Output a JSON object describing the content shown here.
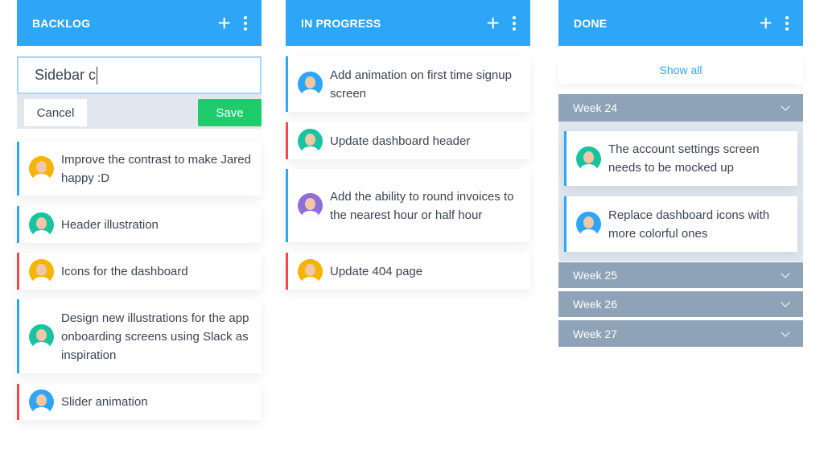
{
  "colors": {
    "header": "#2ea6f8",
    "stripe_blue": "#2ea6f8",
    "stripe_red": "#f4474a",
    "save": "#1fcc6b",
    "week": "#8fa3b8"
  },
  "backlog": {
    "title": "BACKLOG",
    "input_value": "Sidebar c",
    "cancel": "Cancel",
    "save": "Save",
    "cards": [
      {
        "text": "Improve the contrast to make Jared happy :D",
        "stripe": "blue",
        "avatar": "#f5b400"
      },
      {
        "text": "Header illustration",
        "stripe": "blue",
        "avatar": "#19c3a0"
      },
      {
        "text": "Icons for the dashboard",
        "stripe": "red",
        "avatar": "#f5b400"
      },
      {
        "text": "Design new illustrations for the app onboarding screens using Slack as inspiration",
        "stripe": "blue",
        "avatar": "#19c3a0"
      },
      {
        "text": "Slider animation",
        "stripe": "red",
        "avatar": "#2ea6f8"
      }
    ]
  },
  "in_progress": {
    "title": "IN PROGRESS",
    "cards": [
      {
        "text": "Add animation on first time signup screen",
        "stripe": "blue",
        "avatar": "#2ea6f8"
      },
      {
        "text": "Update dashboard header",
        "stripe": "red",
        "avatar": "#19c3a0"
      },
      {
        "text": "Add the ability to round invoices to the nearest hour or half hour",
        "stripe": "blue",
        "avatar": "#8e6fd8"
      },
      {
        "text": "Update 404 page",
        "stripe": "red",
        "avatar": "#f5b400"
      }
    ]
  },
  "done": {
    "title": "DONE",
    "show_all": "Show all",
    "weeks": [
      {
        "label": "Week 24",
        "cards": [
          {
            "text": "The account settings screen needs to be mocked up",
            "avatar": "#19c3a0"
          },
          {
            "text": "Replace dashboard icons with more colorful ones",
            "avatar": "#2ea6f8"
          }
        ]
      },
      {
        "label": "Week 25"
      },
      {
        "label": "Week 26"
      },
      {
        "label": "Week 27"
      }
    ]
  }
}
